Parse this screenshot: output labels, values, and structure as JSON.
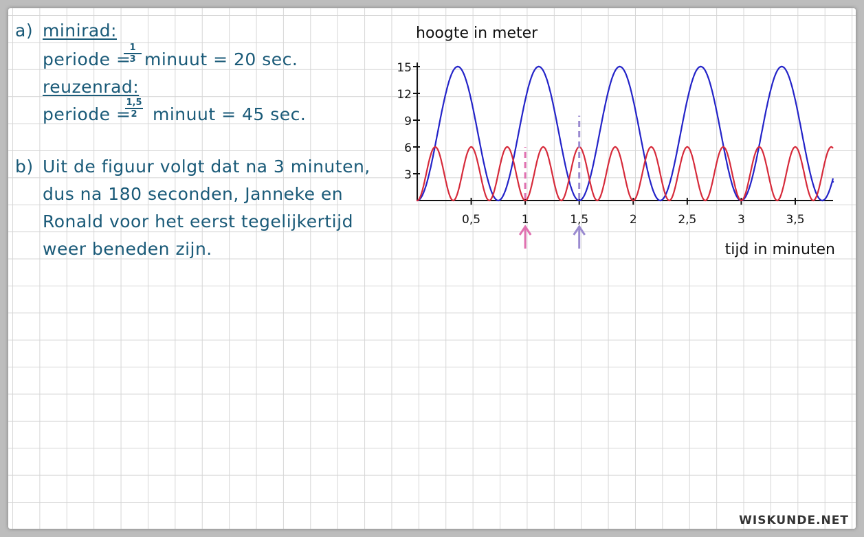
{
  "notes": {
    "a_marker": "a)",
    "minirad_label": "minirad:",
    "periode1_prefix": "periode =",
    "periode1_num": "1",
    "periode1_den": "3",
    "periode1_suffix": "minuut = 20 sec.",
    "reuzenrad_label": "reuzenrad:",
    "periode2_prefix": "periode =",
    "periode2_num": "1,5",
    "periode2_den": "2",
    "periode2_suffix": "minuut = 45 sec.",
    "b_marker": "b)",
    "b_line1": "Uit de figuur volgt dat na 3 minuten,",
    "b_line2": "dus na 180 seconden, Janneke en",
    "b_line3": "Ronald voor het eerst tegelijkertijd",
    "b_line4": "weer beneden zijn."
  },
  "brand": "WISKUNDE.NET",
  "colors": {
    "ink": "#1a5a78",
    "blue_series": "#2323c8",
    "red_series": "#d62a3a",
    "pink_marker": "#e070b0",
    "purple_marker": "#9a8ad0"
  },
  "chart_data": {
    "type": "line",
    "ylabel": "hoogte in meter",
    "xlabel": "tijd in minuten",
    "x_ticks": [
      0.5,
      1,
      1.5,
      2,
      2.5,
      3,
      3.5
    ],
    "x_tick_labels": [
      "0,5",
      "1",
      "1,5",
      "2",
      "2,5",
      "3",
      "3,5"
    ],
    "y_ticks": [
      3,
      6,
      9,
      12,
      15
    ],
    "y_tick_labels": [
      "3",
      "6",
      "9",
      "12",
      "15"
    ],
    "xlim": [
      0,
      3.85
    ],
    "ylim": [
      0,
      15
    ],
    "grid": true,
    "series": [
      {
        "color": "#2323c8",
        "function": "7.5 - 7.5*cos(2*pi*t/0.75)",
        "period": 0.75,
        "min": 0,
        "max": 15,
        "x": [
          0,
          0.375,
          0.75,
          1.125,
          1.5,
          1.875,
          2.25,
          2.625,
          3.0,
          3.375,
          3.75,
          3.85
        ],
        "y": [
          0,
          15,
          0,
          15,
          0,
          15,
          0,
          15,
          0,
          15,
          0,
          2.1
        ]
      },
      {
        "color": "#d62a3a",
        "function": "3 - 3*cos(2*pi*t/(1/3))",
        "period": 0.3333,
        "min": 0,
        "max": 6,
        "x": [
          0,
          0.1667,
          0.3333,
          0.5,
          0.6667,
          0.8333,
          1.0,
          1.1667,
          1.3333,
          1.5,
          1.6667,
          1.8333,
          2.0,
          2.1667,
          2.3333,
          2.5,
          2.6667,
          2.8333,
          3.0,
          3.1667,
          3.3333,
          3.5,
          3.6667,
          3.8333
        ],
        "y": [
          0,
          6,
          0,
          6,
          0,
          6,
          0,
          6,
          0,
          6,
          0,
          6,
          0,
          6,
          0,
          6,
          0,
          6,
          0,
          6,
          0,
          6,
          0,
          6
        ]
      }
    ],
    "annotations": [
      {
        "type": "vline-dashed",
        "x": 1,
        "color": "#e070b0",
        "ymax": 6,
        "arrow": "up"
      },
      {
        "type": "vline-dashed",
        "x": 1.5,
        "color": "#9a8ad0",
        "ymax": 9.5,
        "arrow": "up"
      }
    ]
  }
}
